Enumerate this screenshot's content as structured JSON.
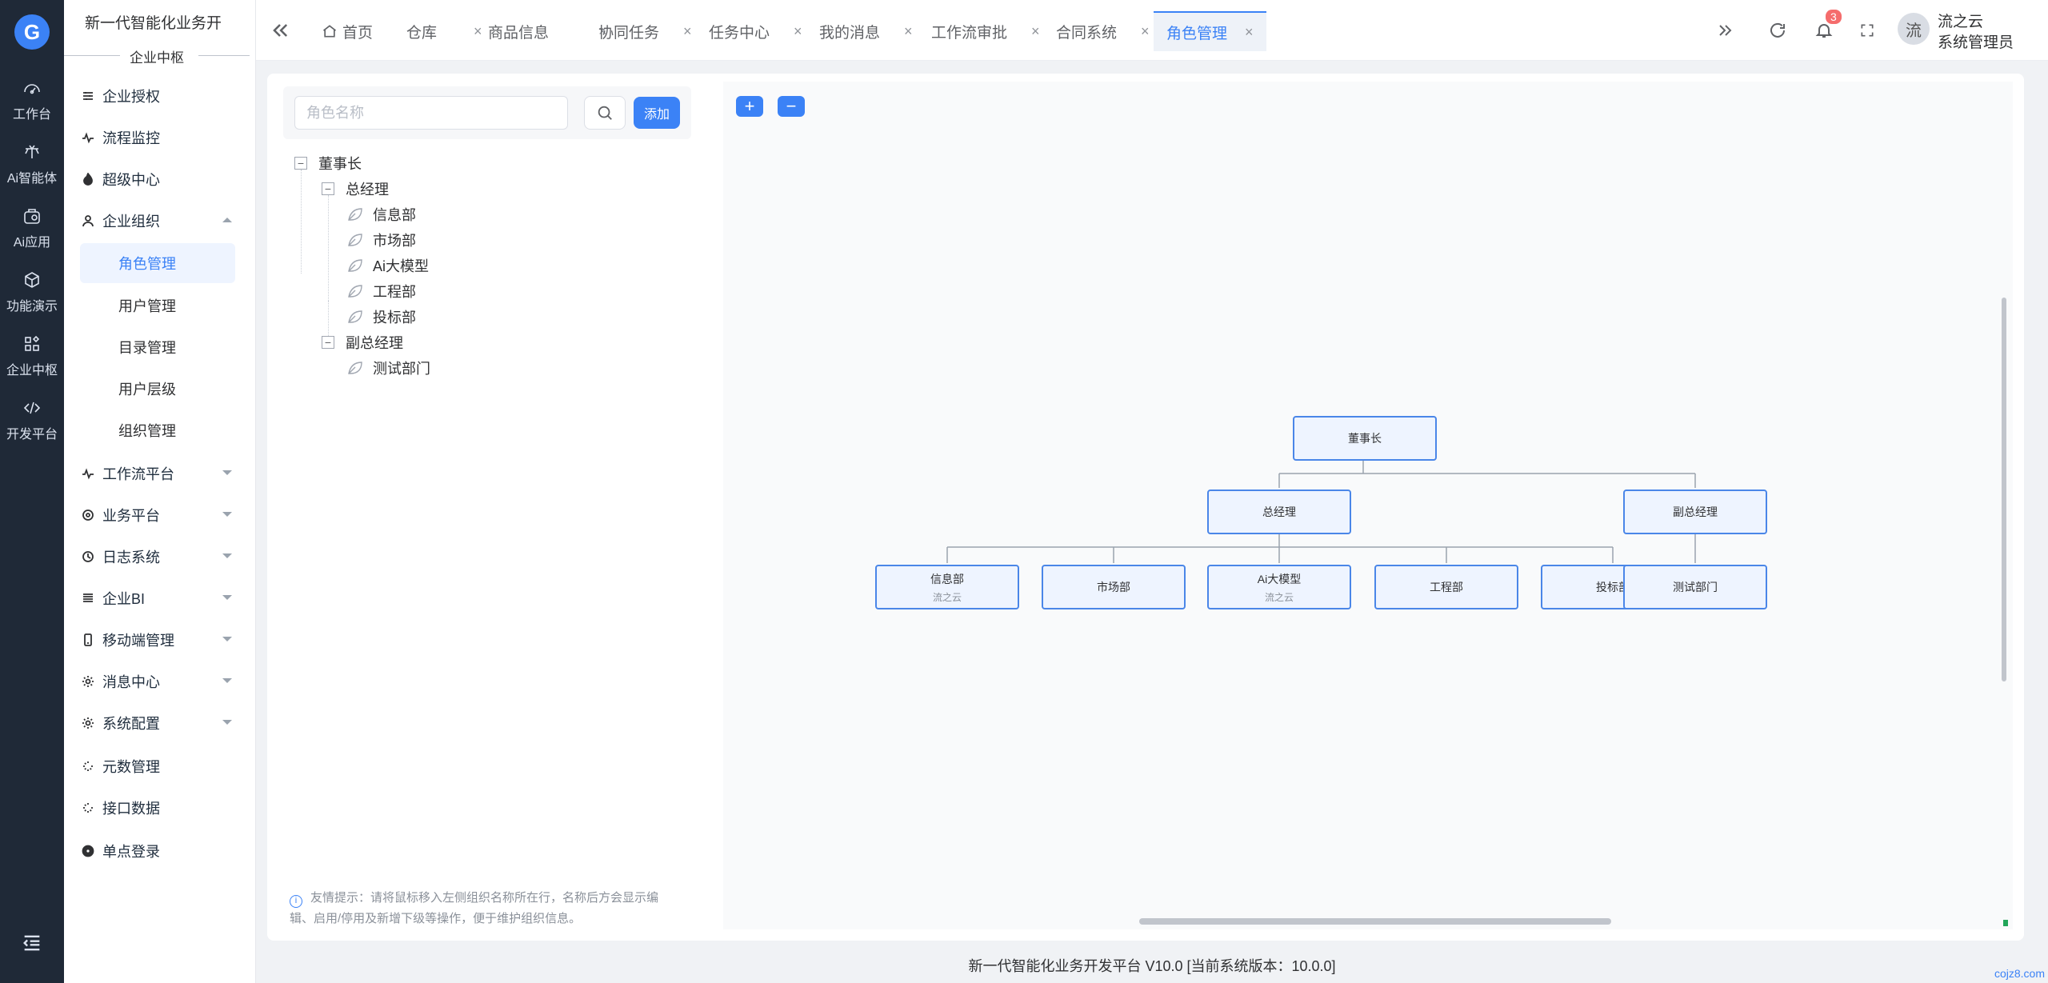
{
  "rail": {
    "items": [
      {
        "label": "工作台",
        "icon": "dashboard-icon"
      },
      {
        "label": "Ai智能体",
        "icon": "ai-agent-icon"
      },
      {
        "label": "Ai应用",
        "icon": "ai-app-icon"
      },
      {
        "label": "功能演示",
        "icon": "cube-icon"
      },
      {
        "label": "企业中枢",
        "icon": "grid-icon"
      },
      {
        "label": "开发平台",
        "icon": "code-icon"
      }
    ]
  },
  "menu": {
    "title": "新一代智能化业务开",
    "subtitle": "企业中枢",
    "items": [
      {
        "label": "企业授权"
      },
      {
        "label": "流程监控"
      },
      {
        "label": "超级中心"
      },
      {
        "label": "企业组织"
      },
      {
        "label": "工作流平台"
      },
      {
        "label": "业务平台"
      },
      {
        "label": "日志系统"
      },
      {
        "label": "企业BI"
      },
      {
        "label": "移动端管理"
      },
      {
        "label": "消息中心"
      },
      {
        "label": "系统配置"
      },
      {
        "label": "元数管理"
      },
      {
        "label": "接口数据"
      },
      {
        "label": "单点登录"
      }
    ],
    "subitems": [
      {
        "label": "角色管理"
      },
      {
        "label": "用户管理"
      },
      {
        "label": "目录管理"
      },
      {
        "label": "用户层级"
      },
      {
        "label": "组织管理"
      }
    ]
  },
  "tabs": [
    {
      "label": "首页"
    },
    {
      "label": "仓库"
    },
    {
      "label": "商品信息"
    },
    {
      "label": "协同任务"
    },
    {
      "label": "任务中心"
    },
    {
      "label": "我的消息"
    },
    {
      "label": "工作流审批"
    },
    {
      "label": "合同系统"
    },
    {
      "label": "角色管理"
    }
  ],
  "tab_close": "×",
  "header": {
    "notification_count": "3",
    "avatar_text": "流",
    "user_name": "流之云",
    "user_role": "系统管理员"
  },
  "panel": {
    "search_placeholder": "角色名称",
    "add_label": "添加",
    "hint": "友情提示：请将鼠标移入左侧组织名称所在行，名称后方会显示编辑、启用/停用及新增下级等操作，便于维护组织信息。"
  },
  "tree": {
    "root": "董事长",
    "gm": "总经理",
    "gm_children": [
      "信息部",
      "市场部",
      "Ai大模型",
      "工程部",
      "投标部"
    ],
    "vgm": "副总经理",
    "vgm_children": [
      "测试部门"
    ]
  },
  "org_chart": {
    "zoom_in": "+",
    "zoom_out": "−",
    "root": "董事长",
    "level1": [
      "总经理",
      "副总经理"
    ],
    "level2": [
      {
        "label": "信息部",
        "sub": "流之云"
      },
      {
        "label": "市场部",
        "sub": ""
      },
      {
        "label": "Ai大模型",
        "sub": "流之云"
      },
      {
        "label": "工程部",
        "sub": ""
      },
      {
        "label": "投标部",
        "sub": ""
      },
      {
        "label": "测试部门",
        "sub": ""
      }
    ]
  },
  "footer": "新一代智能化业务开发平台 V10.0 [当前系统版本：10.0.0]",
  "site_mark": "cojz8.com",
  "colors": {
    "accent": "#3b82f6",
    "rail_bg": "#1f2937",
    "badge": "#f56c6c"
  }
}
